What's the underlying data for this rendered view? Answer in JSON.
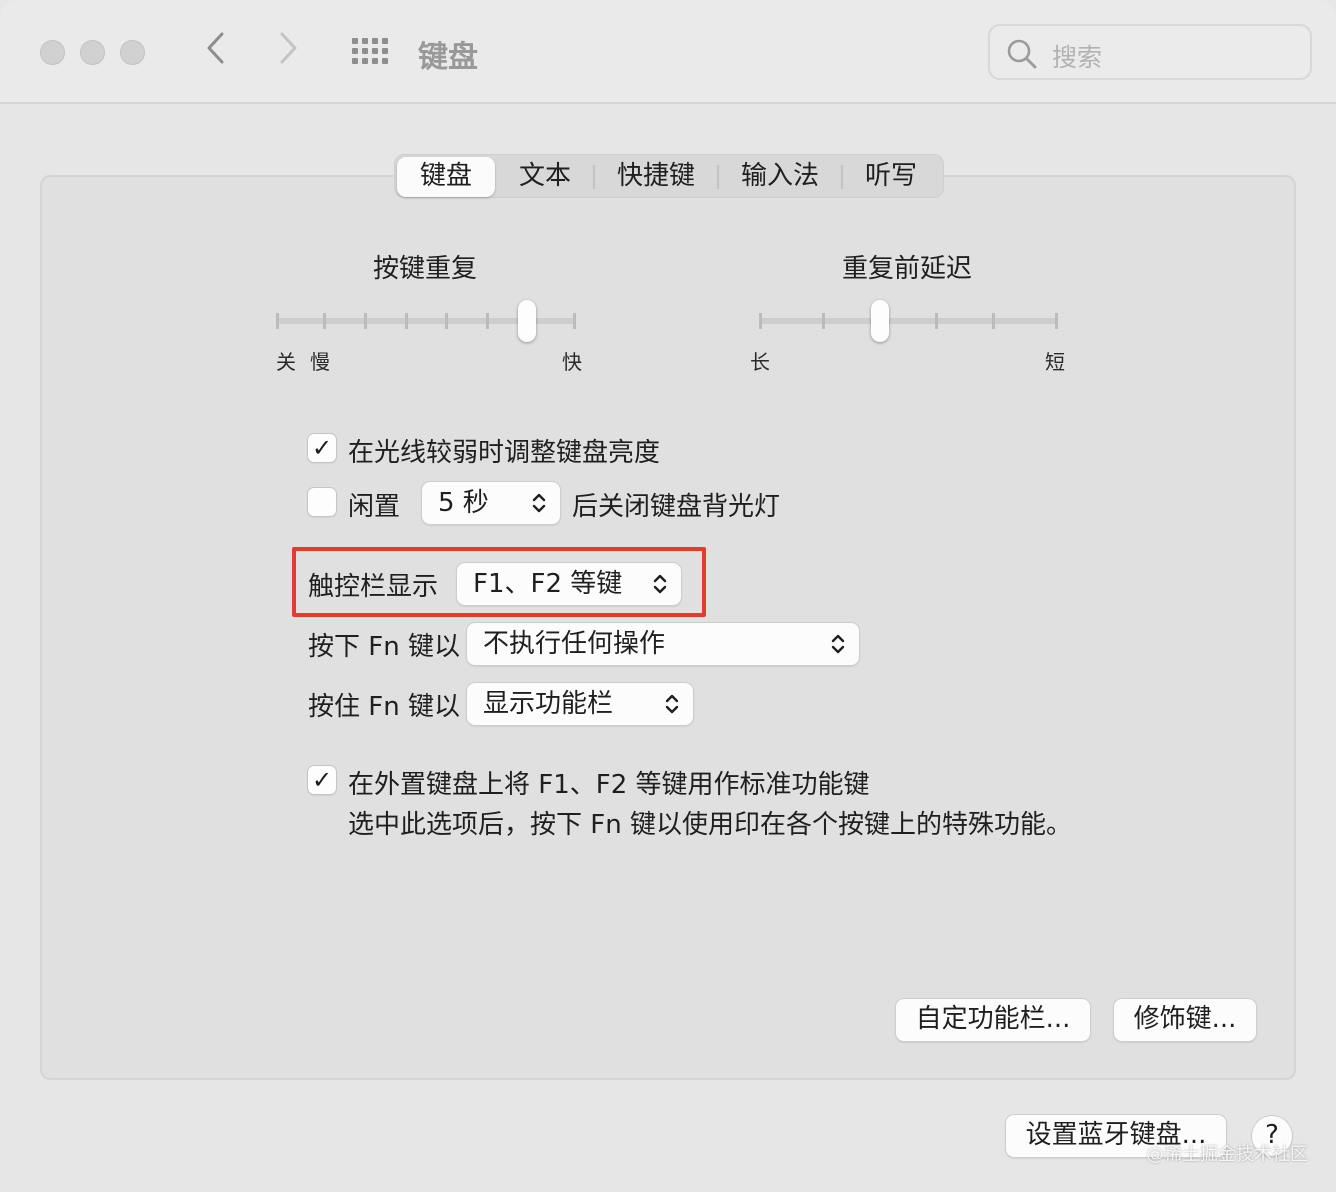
{
  "window": {
    "title": "键盘",
    "search_placeholder": "搜索"
  },
  "tabs": [
    {
      "label": "键盘",
      "active": true
    },
    {
      "label": "文本",
      "active": false
    },
    {
      "label": "快捷键",
      "active": false
    },
    {
      "label": "输入法",
      "active": false
    },
    {
      "label": "听写",
      "active": false
    }
  ],
  "key_repeat": {
    "title": "按键重复",
    "labels": [
      "关",
      "慢",
      "快"
    ],
    "stops": 8,
    "selected_stop": 6
  },
  "repeat_delay": {
    "title": "重复前延迟",
    "labels": [
      "长",
      "短"
    ],
    "stops": 6,
    "selected_stop": 2
  },
  "options": {
    "adjust_brightness": {
      "label": "在光线较弱时调整键盘亮度",
      "checked": true
    },
    "backlight_off": {
      "label_before": "闲置",
      "value": "5 秒",
      "label_after": "后关闭键盘背光灯",
      "checked": false
    },
    "touchbar": {
      "label": "触控栏显示",
      "value": "F1、F2 等键"
    },
    "press_fn": {
      "label": "按下 Fn 键以",
      "value": "不执行任何操作"
    },
    "hold_fn": {
      "label": "按住 Fn 键以",
      "value": "显示功能栏"
    },
    "standard_fn": {
      "label": "在外置键盘上将 F1、F2 等键用作标准功能键",
      "description": "选中此选项后，按下 Fn 键以使用印在各个按键上的特殊功能。",
      "checked": true
    }
  },
  "buttons": {
    "customize_touchbar": "自定功能栏...",
    "modifier_keys": "修饰键...",
    "bluetooth_keyboard": "设置蓝牙键盘...",
    "help": "?"
  },
  "watermark": "@稀土掘金技术社区",
  "colors": {
    "highlight": "#e53a30"
  }
}
